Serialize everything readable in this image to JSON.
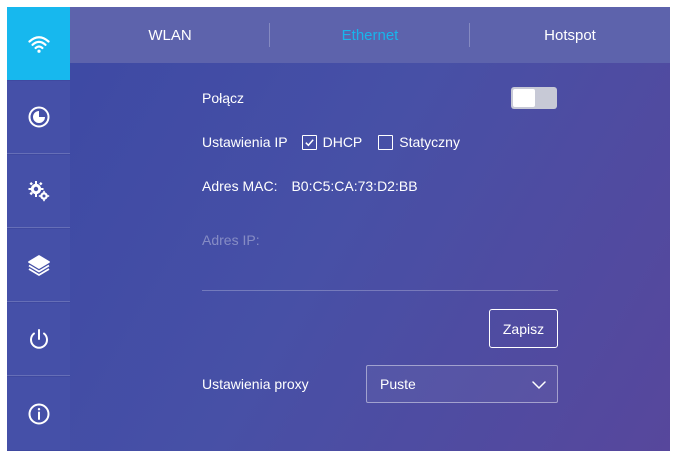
{
  "sidebar": {
    "items": [
      {
        "icon": "wifi-icon",
        "active": true
      },
      {
        "icon": "pie-chart-icon",
        "active": false
      },
      {
        "icon": "settings-gears-icon",
        "active": false
      },
      {
        "icon": "layers-icon",
        "active": false
      },
      {
        "icon": "power-icon",
        "active": false
      },
      {
        "icon": "info-icon",
        "active": false
      }
    ]
  },
  "tabs": [
    {
      "label": "WLAN",
      "active": false
    },
    {
      "label": "Ethernet",
      "active": true
    },
    {
      "label": "Hotspot",
      "active": false
    }
  ],
  "form": {
    "connect_label": "Połącz",
    "connect_enabled": false,
    "ip_settings_label": "Ustawienia IP",
    "ip_options": [
      {
        "label": "DHCP",
        "checked": true
      },
      {
        "label": "Statyczny",
        "checked": false
      }
    ],
    "mac_label": "Adres MAC:",
    "mac_value": "B0:C5:CA:73:D2:BB",
    "ip_label": "Adres IP:",
    "save_label": "Zapisz",
    "proxy_label": "Ustawienia proxy",
    "proxy_value": "Puste"
  },
  "colors": {
    "accent": "#18b5ec",
    "sidebar": "#4550a8",
    "tabbar": "#5d63ac"
  }
}
